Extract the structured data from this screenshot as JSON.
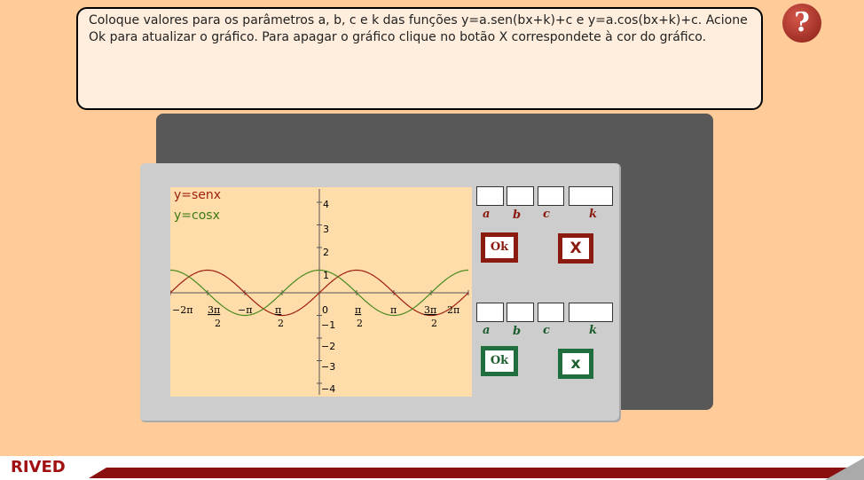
{
  "instruction": {
    "text": "Coloque valores para os parâmetros a, b, c e k  das funções y=a.sen(bx+k)+c e y=a.cos(bx+k)+c. Acione Ok para atualizar o gráfico. Para apagar o gráfico clique no botão X correspondete à cor do gráfico."
  },
  "help_button": {
    "label": "?"
  },
  "graph": {
    "legend_sin": "y=senx",
    "legend_cos": "y=cosx",
    "sin_color": "#a02010",
    "cos_color": "#4a8a20",
    "x_tick_labels": [
      "−2π",
      "3π",
      "2",
      "−π",
      "π",
      "2",
      "0",
      "π",
      "2",
      "π",
      "3π",
      "2",
      "2π"
    ],
    "y_tick_labels": [
      "4",
      "3",
      "2",
      "1",
      "−1",
      "−2",
      "−3",
      "−4"
    ]
  },
  "chart_data": {
    "type": "line",
    "series": [
      {
        "name": "y=senx",
        "function": "sin"
      },
      {
        "name": "y=cosx",
        "function": "cos"
      }
    ],
    "xlim": [
      -6.2832,
      6.2832
    ],
    "ylim": [
      -4,
      4
    ],
    "x_ticks": [
      "−2π",
      "−3π/2",
      "−π",
      "−π/2",
      "0",
      "π/2",
      "π",
      "3π/2",
      "2π"
    ],
    "y_ticks": [
      "4",
      "3",
      "2",
      "1",
      "0",
      "−1",
      "−2",
      "−3",
      "−4"
    ],
    "grid": false
  },
  "params": {
    "labels": [
      "a",
      "b",
      "c",
      "k"
    ],
    "sin_color": "#8b1a10",
    "cos_color": "#1e5e2e"
  },
  "sin_controls": {
    "ok_label": "Ok",
    "x_label": "x"
  },
  "cos_controls": {
    "ok_label": "Ok",
    "x_label": "x"
  },
  "footer": {
    "logo": "RIVED"
  }
}
